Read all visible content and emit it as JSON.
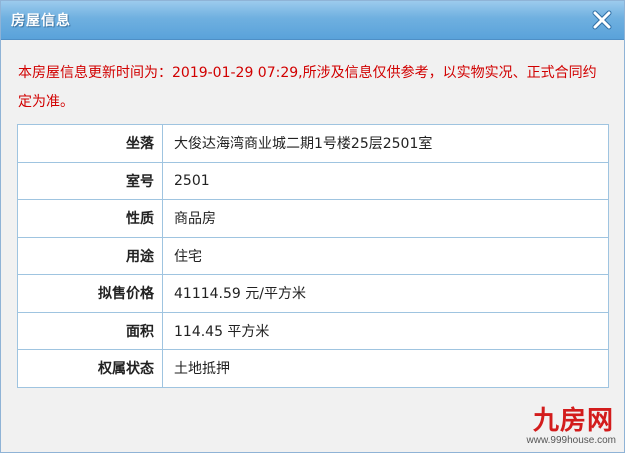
{
  "dialog": {
    "title": "房屋信息",
    "close_icon": "close-icon"
  },
  "notice": "本房屋信息更新时间为：2019-01-29 07:29,所涉及信息仅供参考，以实物实况、正式合同约定为准。",
  "rows": [
    {
      "label": "坐落",
      "value": "大俊达海湾商业城二期1号楼25层2501室"
    },
    {
      "label": "室号",
      "value": "2501"
    },
    {
      "label": "性质",
      "value": "商品房"
    },
    {
      "label": "用途",
      "value": "住宅"
    },
    {
      "label": "拟售价格",
      "value": "41114.59 元/平方米"
    },
    {
      "label": "面积",
      "value": "114.45 平方米"
    },
    {
      "label": "权属状态",
      "value": "土地抵押"
    }
  ],
  "watermark": {
    "logo": "九房网",
    "url": "www.999house.com"
  },
  "colors": {
    "titlebar": "#5aa2da",
    "notice_text": "#d10000",
    "table_border": "#9fc4e0"
  }
}
